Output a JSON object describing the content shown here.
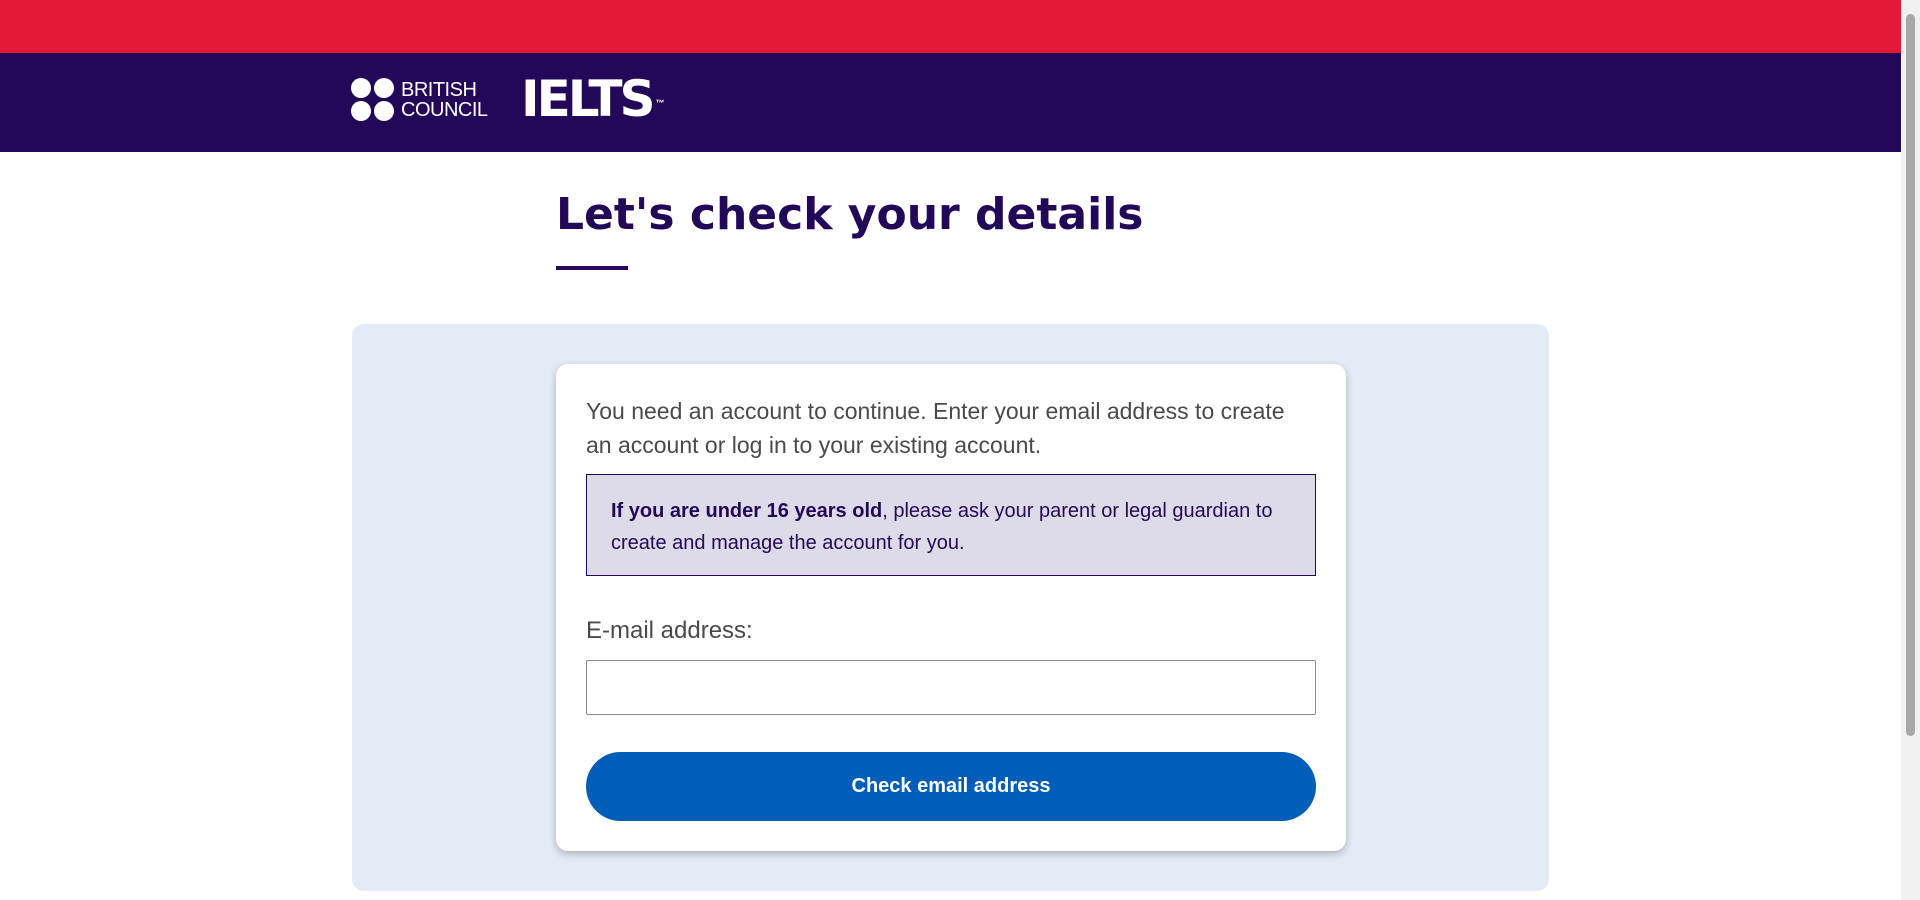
{
  "branding": {
    "bc_line1": "BRITISH",
    "bc_line2": "COUNCIL",
    "ielts": "IELTS",
    "trademark": "™",
    "colors": {
      "top_strip": "#e41937",
      "header": "#23085a",
      "button": "#005eb8",
      "panel": "#e3ecf6"
    }
  },
  "page": {
    "title": "Let's check your details"
  },
  "form": {
    "intro": "You need an account to continue. Enter your email address to create an account or log in to your existing account.",
    "notice_bold": "If you are under 16 years old",
    "notice_rest": ", please ask your parent or legal guardian to create and manage the account for you.",
    "email_label": "E-mail address:",
    "email_value": "",
    "email_placeholder": "",
    "submit_label": "Check email address"
  }
}
